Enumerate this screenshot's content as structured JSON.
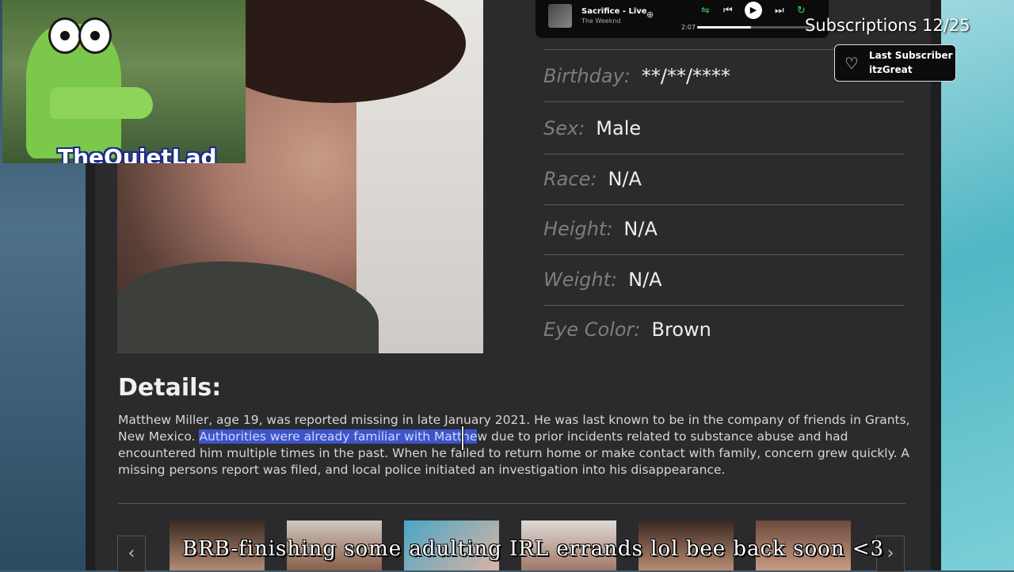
{
  "profile": {
    "name": "Matthew Miller",
    "fields": [
      {
        "label": "Birthday:",
        "value": "**/**/****"
      },
      {
        "label": "Sex:",
        "value": "Male"
      },
      {
        "label": "Race:",
        "value": "N/A"
      },
      {
        "label": "Height:",
        "value": "N/A"
      },
      {
        "label": "Weight:",
        "value": "N/A"
      },
      {
        "label": "Eye Color:",
        "value": "Brown"
      }
    ]
  },
  "details": {
    "title": "Details:",
    "text_before": "Matthew Miller, age 19, was reported missing in late January 2021. He was last known to be in the company of friends in Grants, New Mexico. ",
    "highlighted": "Authorities were already familiar with Matthe",
    "text_after": "w due to prior incidents related to substance abuse and had encountered him multiple times in the past. When he failed to return home or make contact with family, concern grew quickly. A missing persons report was filed, and local police initiated an investigation into his disappearance."
  },
  "overlay": {
    "brand": "TheQuietLad",
    "subscriptions": "Subscriptions 12/25",
    "last_subscriber_label": "Last Subscriber",
    "last_subscriber_name": "itzGreat",
    "ticker": "BRB-finishing some adulting IRL errands lol bee back soon <3"
  },
  "player": {
    "song": "Sacrifice - Live",
    "artist": "The Weeknd",
    "elapsed": "2:07",
    "progress_fraction": 0.45
  },
  "colors": {
    "highlight": "#3d55c9",
    "panel": "#2b2b2d",
    "label": "#7d7d80",
    "value": "#eeeeee"
  }
}
